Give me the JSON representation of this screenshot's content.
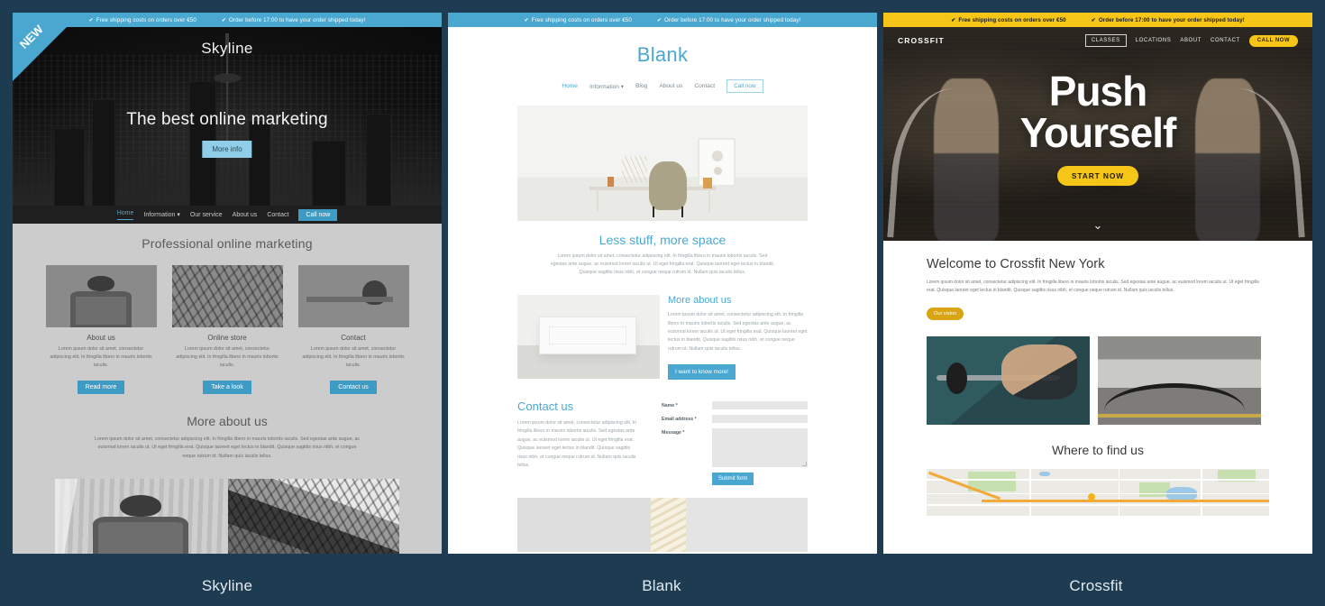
{
  "announcement": {
    "tick": "✔",
    "item1": "Free shipping costs on orders over €50",
    "item2": "Order before 17:00 to have your order shipped today!"
  },
  "labels": {
    "skyline": "Skyline",
    "blank": "Blank",
    "crossfit": "Crossfit"
  },
  "skyline": {
    "ribbon": "NEW",
    "site_title": "Skyline",
    "headline": "The best online marketing",
    "hero_button": "More info",
    "nav": [
      {
        "label": "Home",
        "active": true
      },
      {
        "label": "Information ▾",
        "active": false
      },
      {
        "label": "Our service",
        "active": false
      },
      {
        "label": "About us",
        "active": false
      },
      {
        "label": "Contact",
        "active": false
      }
    ],
    "nav_cta": "Call now",
    "section_title": "Professional online marketing",
    "columns": [
      {
        "title": "About us",
        "text": "Lorem ipsum dolor sit amet, consectetur adipiscing elit. In fringilla libero in mauris lobortis iaculis.",
        "button": "Read more"
      },
      {
        "title": "Online store",
        "text": "Lorem ipsum dolor sit amet, consectetur adipiscing elit. In fringilla libero in mauris lobortis iaculis.",
        "button": "Take a look"
      },
      {
        "title": "Contact",
        "text": "Lorem ipsum dolor sit amet, consectetur adipiscing elit. In fringilla libero in mauris lobortis iaculis.",
        "button": "Contact us"
      }
    ],
    "more_title": "More about us",
    "more_text": "Lorem ipsum dolor sit amet, consectetur adipiscing elit. In fringilla libero in mauris lobortis iaculis. Sed egestas ante augue, ac euismod lorem iaculis ut. Ut eget fringilla erat. Quisque laoreet eget lectus in blandit. Quisque sagittis risus nibh, et congue neque rutrum id. Nullam quis iaculis tellus."
  },
  "blank": {
    "site_title": "Blank",
    "nav": [
      {
        "label": "Home",
        "active": true
      },
      {
        "label": "Information ▾",
        "active": false
      },
      {
        "label": "Blog",
        "active": false
      },
      {
        "label": "About us",
        "active": false
      },
      {
        "label": "Contact",
        "active": false
      }
    ],
    "nav_cta": "Call now",
    "section_title": "Less stuff, more space",
    "section_text": "Lorem ipsum dolor sit amet, consectetur adipiscing elit. In fringilla libero in mauris lobortis iaculis. Sed egestas ante augue, ac euismod lorem iaculis ut. Ut eget fringilla erat. Quisque laoreet eget lectus in blandit. Quisque sagittis risus nibh, et congue neque rutrum id. Nullam quis iaculis tellus.",
    "about_title": "More about us",
    "about_text": "Lorem ipsum dolor sit amet, consectetur adipiscing elit. In fringilla libero in mauris lobortis iaculis. Sed egestas ante augue, ac euismod lorem iaculis ut. Ut eget fringilla erat. Quisque laoreet eget lectus in blandit. Quisque sagittis risus nibh, et congue neque rutrum id. Nullam quis iaculis tellus.",
    "about_button": "I want to know more!",
    "contact_title": "Contact us",
    "contact_text": "Lorem ipsum dolor sit amet, consectetur adipiscing elit. In fringilla libero in mauris lobortis iaculis. Sed egestas ante augue, ac euismod lorem iaculis ut. Ut eget fringilla erat. Quisque laoreet eget lectus in blandit. Quisque sagittis risus nibh, et congue neque rutrum id. Nullam quis iaculis tellus.",
    "form": {
      "name_label": "Name *",
      "name_value": "",
      "email_label": "Email address *",
      "email_value": "",
      "message_label": "Message *",
      "message_value": "",
      "submit": "Submit form"
    }
  },
  "crossfit": {
    "logo": "CROSSFIT",
    "nav": [
      {
        "label": "CLASSES",
        "boxed": true
      },
      {
        "label": "LOCATIONS",
        "boxed": false
      },
      {
        "label": "ABOUT",
        "boxed": false
      },
      {
        "label": "CONTACT",
        "boxed": false
      }
    ],
    "nav_cta": "CALL NOW",
    "hero_line1": "Push",
    "hero_line2": "Yourself",
    "hero_button": "START NOW",
    "scroll_icon": "⌄",
    "welcome_title": "Welcome to Crossfit New York",
    "welcome_text": "Lorem ipsum dolor sit amet, consectetur adipiscing elit. In fringilla libero in mauris lobortis iaculis. Sed egestas ante augue, ac euismod lorem iaculis ut. Ut eget fringilla erat. Quisque laoreet eget lectus in blandit. Quisque sagittis risus nibh, et congue neque rutrum id. Nullam quis iaculis tellus.",
    "vision_button": "Our vision",
    "find_title": "Where to find us"
  },
  "colors": {
    "page_bg": "#1d3c52",
    "accent_blue": "#4aa8d0",
    "accent_yellow": "#f5c518",
    "crossfit_gold": "#d9a514",
    "skyline_body": "#cccccc"
  }
}
